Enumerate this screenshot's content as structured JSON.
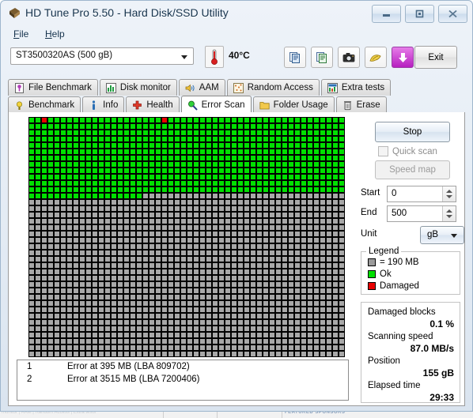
{
  "window": {
    "title": "HD Tune Pro 5.50 - Hard Disk/SSD Utility",
    "icon": "hdtune-app-icon",
    "buttons": {
      "minimize": "minimize-icon",
      "maximize": "maximize-icon",
      "close": "close-icon"
    }
  },
  "menu": {
    "file": "File",
    "help": "Help"
  },
  "toolbar": {
    "drive": "ST3500320AS (500 gB)",
    "drive_arrow": "chevron-down-icon",
    "temperature": "40°C",
    "thermometer_icon": "thermometer-icon",
    "icons": [
      {
        "name": "copy-icon",
        "glyph": "copy"
      },
      {
        "name": "export-icon",
        "glyph": "export"
      },
      {
        "name": "screenshot-camera-icon",
        "glyph": "camera"
      },
      {
        "name": "folder-options-icon",
        "glyph": "options"
      },
      {
        "name": "download-arrow-icon",
        "glyph": "download"
      }
    ],
    "exit_label": "Exit"
  },
  "tabs": {
    "row1": [
      {
        "label": "File Benchmark",
        "icon": "file-benchmark-icon",
        "active": false
      },
      {
        "label": "Disk monitor",
        "icon": "disk-monitor-icon",
        "active": false
      },
      {
        "label": "AAM",
        "icon": "aam-speaker-icon",
        "active": false
      },
      {
        "label": "Random Access",
        "icon": "random-access-icon",
        "active": false
      },
      {
        "label": "Extra tests",
        "icon": "extra-tests-icon",
        "active": false
      }
    ],
    "row2": [
      {
        "label": "Benchmark",
        "icon": "benchmark-icon",
        "active": false
      },
      {
        "label": "Info",
        "icon": "info-icon",
        "active": false
      },
      {
        "label": "Health",
        "icon": "health-cross-icon",
        "active": false
      },
      {
        "label": "Error Scan",
        "icon": "error-scan-magnifier-icon",
        "active": true
      },
      {
        "label": "Folder Usage",
        "icon": "folder-usage-icon",
        "active": false
      },
      {
        "label": "Erase",
        "icon": "erase-trash-icon",
        "active": false
      }
    ]
  },
  "scan": {
    "columns": 50,
    "rows": 38,
    "ok_rows": 12,
    "partial_row_ok_columns": 18,
    "damaged_cells": [
      {
        "row": 0,
        "col": 2
      },
      {
        "row": 0,
        "col": 21
      }
    ]
  },
  "errors": {
    "rows": [
      {
        "index": "1",
        "text": "Error at 395 MB (LBA 809702)"
      },
      {
        "index": "2",
        "text": "Error at 3515 MB (LBA 7200406)"
      }
    ]
  },
  "controls": {
    "stop_label": "Stop",
    "quick_scan_label": "Quick scan",
    "quick_scan_checked": false,
    "speed_map_label": "Speed map",
    "start_label": "Start",
    "start_value": "0",
    "end_label": "End",
    "end_value": "500",
    "unit_label": "Unit",
    "unit_value": "gB"
  },
  "legend": {
    "title": "Legend",
    "block_size": "= 190 MB",
    "ok_label": "Ok",
    "damaged_label": "Damaged"
  },
  "stats": [
    {
      "label": "Damaged blocks",
      "value": "0.1 %"
    },
    {
      "label": "Scanning speed",
      "value": "87.0 MB/s"
    },
    {
      "label": "Position",
      "value": "155 gB"
    },
    {
      "label": "Elapsed time",
      "value": "29:33"
    }
  ],
  "background": {
    "strip_left": "monitor  |  AAM  |  Random Access  |  Extra tests",
    "strip_right": "FEATURED SPONSORS"
  },
  "colors": {
    "ok": "#00e000",
    "damaged": "#e80000",
    "unscanned": "#a8a8a8",
    "accent": "#b61ec0",
    "title": "#16334d"
  }
}
